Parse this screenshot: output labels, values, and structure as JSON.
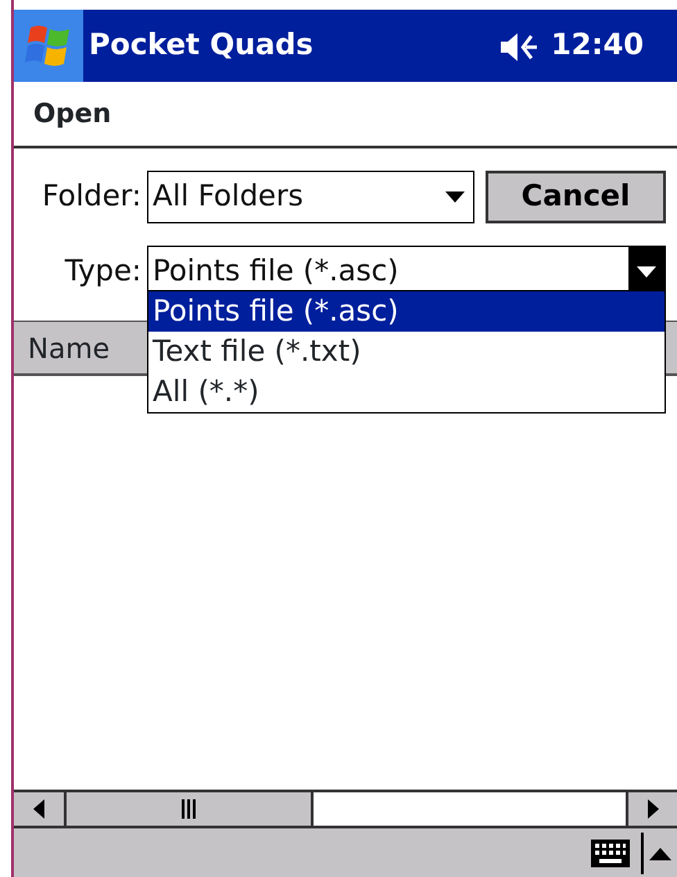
{
  "title_bar": {
    "title": "Pocket Quads",
    "time": "12:40"
  },
  "dialog": {
    "title": "Open"
  },
  "folder": {
    "label": "Folder:",
    "value": "All Folders"
  },
  "cancel_button": "Cancel",
  "type": {
    "label": "Type:",
    "value": "Points file (*.asc)",
    "expanded": true,
    "options": [
      {
        "label": "Points file (*.asc)",
        "selected": true
      },
      {
        "label": "Text file (*.txt)",
        "selected": false
      },
      {
        "label": "All (*.*)",
        "selected": false
      }
    ]
  },
  "columns": [
    "Name"
  ]
}
